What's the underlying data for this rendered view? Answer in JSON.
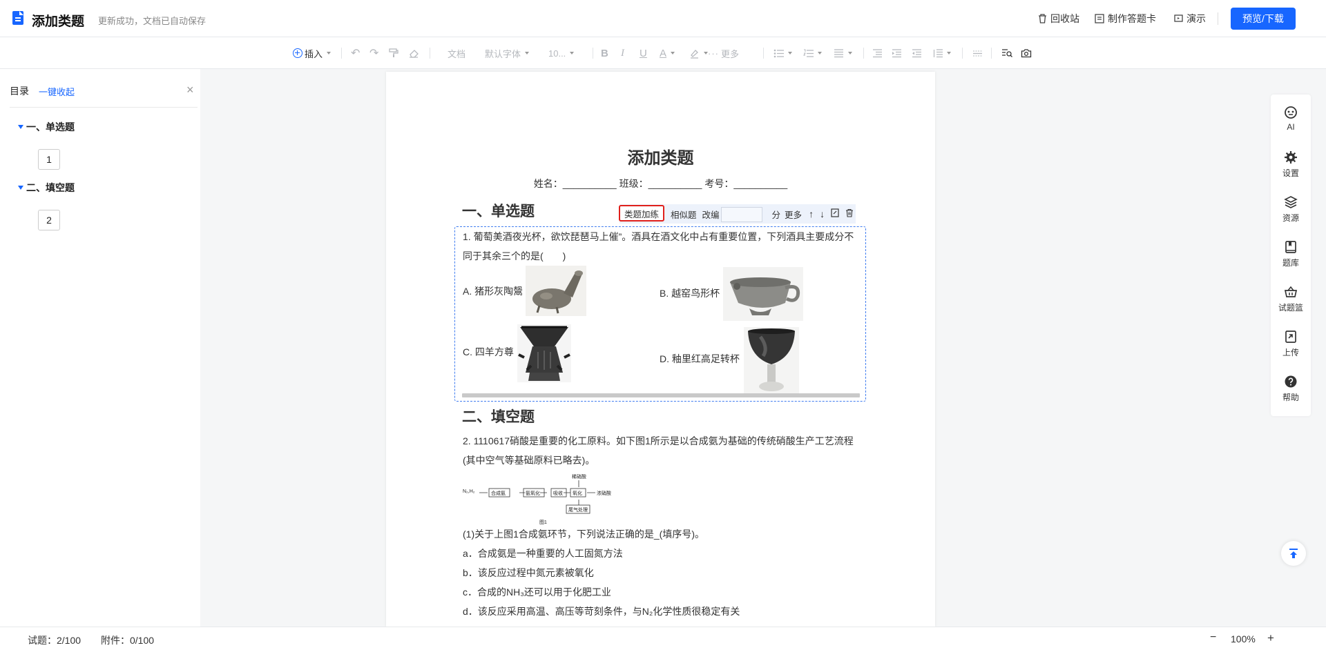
{
  "header": {
    "title": "添加类题",
    "save_status": "更新成功，文档已自动保存",
    "recycle": "回收站",
    "answer_card": "制作答题卡",
    "present": "演示",
    "preview_download": "预览/下载"
  },
  "toolbar": {
    "insert": "插入",
    "doc_style": "文档",
    "font": "默认字体",
    "font_size": "10...",
    "more": "更多"
  },
  "toc": {
    "title": "目录",
    "collapse_all": "一键收起",
    "sections": [
      {
        "label": "一、单选题",
        "items": [
          "1"
        ]
      },
      {
        "label": "二、填空题",
        "items": [
          "2"
        ]
      }
    ]
  },
  "document": {
    "title": "添加类题",
    "meta": "姓名：__________ 班级：__________ 考号：__________",
    "section1": "一、单选题",
    "section2": "二、填空题",
    "question_toolbar": {
      "similar_practice": "类题加练",
      "similar": "相似题",
      "edit": "改编",
      "score_unit": "分",
      "more": "更多"
    },
    "q1": {
      "line1": "1. 葡萄美酒夜光杯，欲饮琵琶马上催”。酒具在酒文化中占有重要位置，下列酒具主要成分不",
      "line2": "同于其余三个的是(　　)",
      "options": {
        "a": "A.  猪形灰陶鬶",
        "b": "B.  越窑鸟形杯",
        "c": "C.  四羊方尊",
        "d": "D.  釉里红高足转杯"
      }
    },
    "q2": {
      "line1": "2. 1110617硝酸是重要的化工原料。如下图1所示是以合成氨为基础的传统硝酸生产工艺流程",
      "line2": "(其中空气等基础原料已略去)。",
      "figure_caption": "图1",
      "flow_labels": {
        "start": "N₂,H₂",
        "step1": "合成氨",
        "step2": "氨氧化",
        "step3": "吸收",
        "step4": "氧化",
        "top": "稀硝酸",
        "end": "浓硝酸",
        "bottom": "尾气处理"
      },
      "sub1": "(1)关于上图1合成氨环节，下列说法正确的是_(填序号)。",
      "a": "a．合成氨是一种重要的人工固氮方法",
      "b": "b．该反应过程中氮元素被氧化",
      "c": "c．合成的NH₃还可以用于化肥工业",
      "d": "d．该反应采用高温、高压等苛刻条件，与N₂化学性质很稳定有关"
    }
  },
  "right_panel": {
    "ai": "AI",
    "settings": "设置",
    "resources": "资源",
    "question_bank": "题库",
    "basket": "试题篮",
    "upload": "上传",
    "help": "帮助"
  },
  "status": {
    "questions": "试题：2/100",
    "attachments": "附件：0/100",
    "zoom_out": "−",
    "zoom": "100%",
    "zoom_in": "+"
  },
  "colors": {
    "accent": "#1766ff",
    "highlight_border": "#e0201b",
    "selection_border": "#3f7cf0"
  }
}
